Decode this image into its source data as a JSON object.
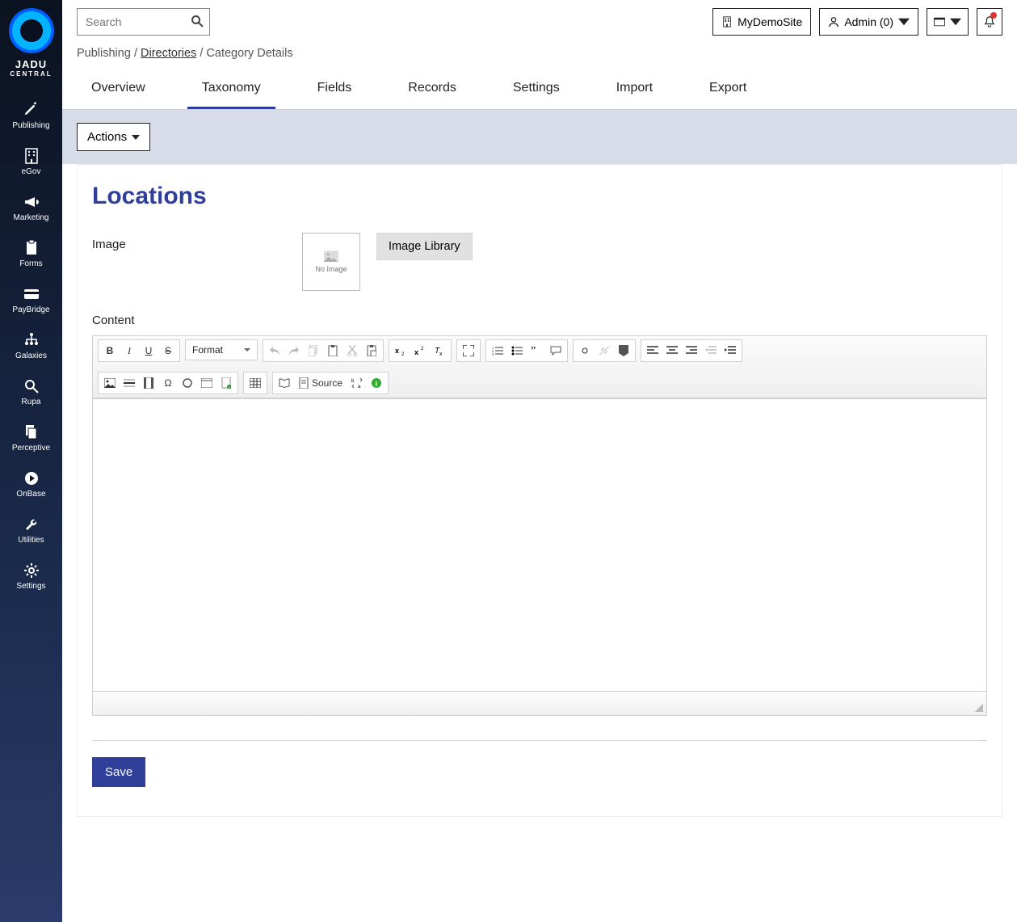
{
  "brand": {
    "name": "JADU",
    "sub": "CENTRAL"
  },
  "sidebar": [
    {
      "label": "Publishing",
      "icon": "pencil"
    },
    {
      "label": "eGov",
      "icon": "building"
    },
    {
      "label": "Marketing",
      "icon": "bullhorn"
    },
    {
      "label": "Forms",
      "icon": "clipboard"
    },
    {
      "label": "PayBridge",
      "icon": "card"
    },
    {
      "label": "Galaxies",
      "icon": "sitemap"
    },
    {
      "label": "Rupa",
      "icon": "search"
    },
    {
      "label": "Perceptive",
      "icon": "copy"
    },
    {
      "label": "OnBase",
      "icon": "play"
    },
    {
      "label": "Utilities",
      "icon": "wrench"
    },
    {
      "label": "Settings",
      "icon": "gear"
    }
  ],
  "search": {
    "placeholder": "Search"
  },
  "header": {
    "site": "MyDemoSite",
    "user": "Admin (0)"
  },
  "breadcrumb": {
    "a": "Publishing",
    "b": "Directories",
    "c": "Category Details"
  },
  "tabs": [
    "Overview",
    "Taxonomy",
    "Fields",
    "Records",
    "Settings",
    "Import",
    "Export"
  ],
  "activeTab": 1,
  "actions_label": "Actions",
  "page_title": "Locations",
  "fields": {
    "image_label": "Image",
    "no_image": "No Image",
    "image_library": "Image Library",
    "content_label": "Content",
    "format_label": "Format",
    "source_label": "Source"
  },
  "save_label": "Save"
}
